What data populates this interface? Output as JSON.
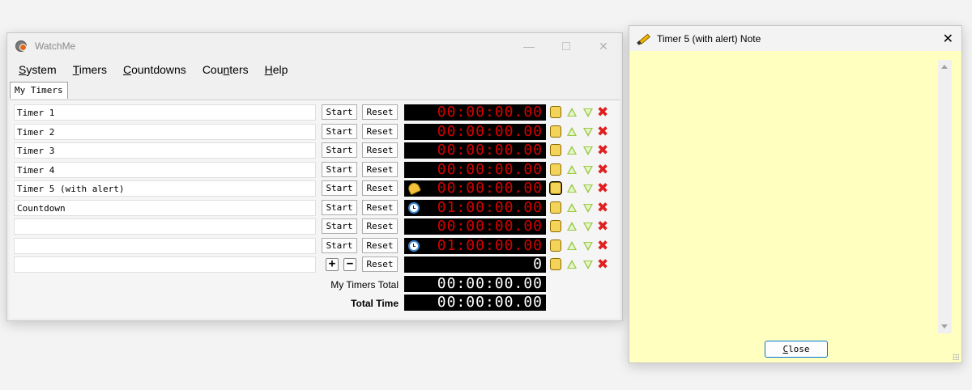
{
  "main_window": {
    "title": "WatchMe",
    "controls": {
      "minimize": "—",
      "close": "✕"
    },
    "menu": [
      {
        "label": "System",
        "mnemonic": "S",
        "rest": "ystem"
      },
      {
        "label": "Timers",
        "mnemonic": "T",
        "rest": "imers"
      },
      {
        "label": "Countdowns",
        "mnemonic": "C",
        "rest": "ountdowns"
      },
      {
        "label": "Counters",
        "pre": "Cou",
        "mnemonic": "n",
        "rest": "ters"
      },
      {
        "label": "Help",
        "mnemonic": "H",
        "rest": "elp"
      }
    ],
    "tab": "My Timers",
    "buttons": {
      "start": "Start",
      "reset": "Reset",
      "plus": "+",
      "minus": "−"
    },
    "rows": [
      {
        "name": "Timer 1",
        "display": "00:00:00.00",
        "type": "timer",
        "icon": ""
      },
      {
        "name": "Timer 2",
        "display": "00:00:00.00",
        "type": "timer",
        "icon": ""
      },
      {
        "name": "Timer 3",
        "display": "00:00:00.00",
        "type": "timer",
        "icon": ""
      },
      {
        "name": "Timer 4",
        "display": "00:00:00.00",
        "type": "timer",
        "icon": ""
      },
      {
        "name": "Timer 5 (with alert)",
        "display": "00:00:00.00",
        "type": "timer",
        "icon": "bell-icon"
      },
      {
        "name": "Countdown",
        "display": "01:00:00.00",
        "type": "timer",
        "icon": "alarm-clock-icon"
      },
      {
        "name": "",
        "display": "00:00:00.00",
        "type": "timer",
        "icon": ""
      },
      {
        "name": "",
        "display": "01:00:00.00",
        "type": "timer",
        "icon": "alarm-clock-icon"
      },
      {
        "name": "",
        "display": "0",
        "type": "counter",
        "icon": ""
      }
    ],
    "totals": [
      {
        "label": "My Timers Total",
        "value": "00:00:00.00",
        "bold": false
      },
      {
        "label": "Total Time",
        "value": "00:00:00.00",
        "bold": true
      }
    ],
    "colors": {
      "display_bg": "#000000",
      "display_red": "#d40000",
      "display_white": "#ffffff",
      "delete_red": "#e02020",
      "arrow_green": "#9bc94a",
      "note_yellow": "#f4d35a"
    }
  },
  "note_window": {
    "title": "Timer 5 (with alert) Note",
    "close_x": "✕",
    "text": "",
    "close_button": {
      "mnemonic": "C",
      "rest": "lose"
    },
    "colors": {
      "background": "#ffffc0"
    }
  }
}
